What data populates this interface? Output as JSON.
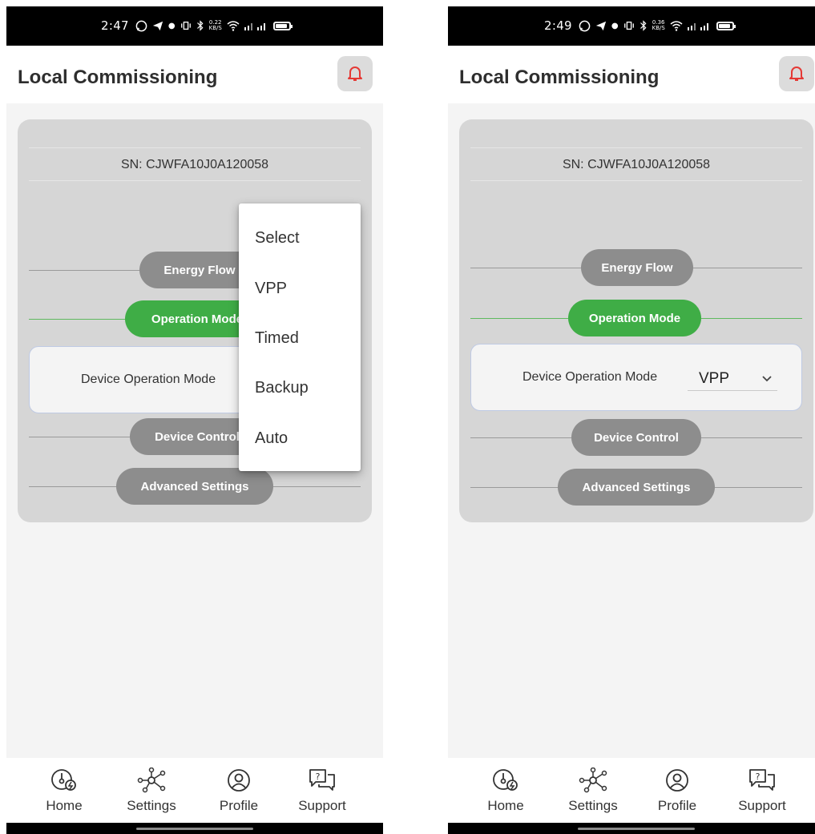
{
  "left": {
    "status": {
      "time": "2:47",
      "speed_top": "0.22",
      "speed_bottom": "KB/S"
    },
    "header": {
      "title": "Local Commissioning"
    },
    "card": {
      "sn": "SN: CJWFA10J0A120058",
      "sections": [
        "Energy Flow",
        "Operation Mode",
        "Device Control",
        "Advanced Settings"
      ],
      "device_operation_mode_label": "Device Operation Mode"
    },
    "dropdown": {
      "options": [
        "Select",
        "VPP",
        "Timed",
        "Backup",
        "Auto"
      ]
    }
  },
  "right": {
    "status": {
      "time": "2:49",
      "speed_top": "0.36",
      "speed_bottom": "KB/S"
    },
    "header": {
      "title": "Local Commissioning"
    },
    "card": {
      "sn": "SN: CJWFA10J0A120058",
      "sections": [
        "Energy Flow",
        "Operation Mode",
        "Device Control",
        "Advanced Settings"
      ],
      "device_operation_mode_label": "Device Operation Mode",
      "device_operation_mode_value": "VPP"
    }
  },
  "nav": {
    "items": [
      "Home",
      "Settings",
      "Profile",
      "Support"
    ]
  },
  "colors": {
    "accent_green": "#3fad46",
    "pill_grey": "#8d8d8d",
    "bell_red": "#e53935"
  },
  "icons": [
    "whatsapp-icon",
    "telegram-icon",
    "vibrate-icon",
    "bluetooth-icon",
    "wifi-icon",
    "signal-icon",
    "battery-icon",
    "bell-icon",
    "home-gauge-icon",
    "settings-network-icon",
    "profile-icon",
    "support-chat-icon",
    "chevron-down-icon"
  ]
}
